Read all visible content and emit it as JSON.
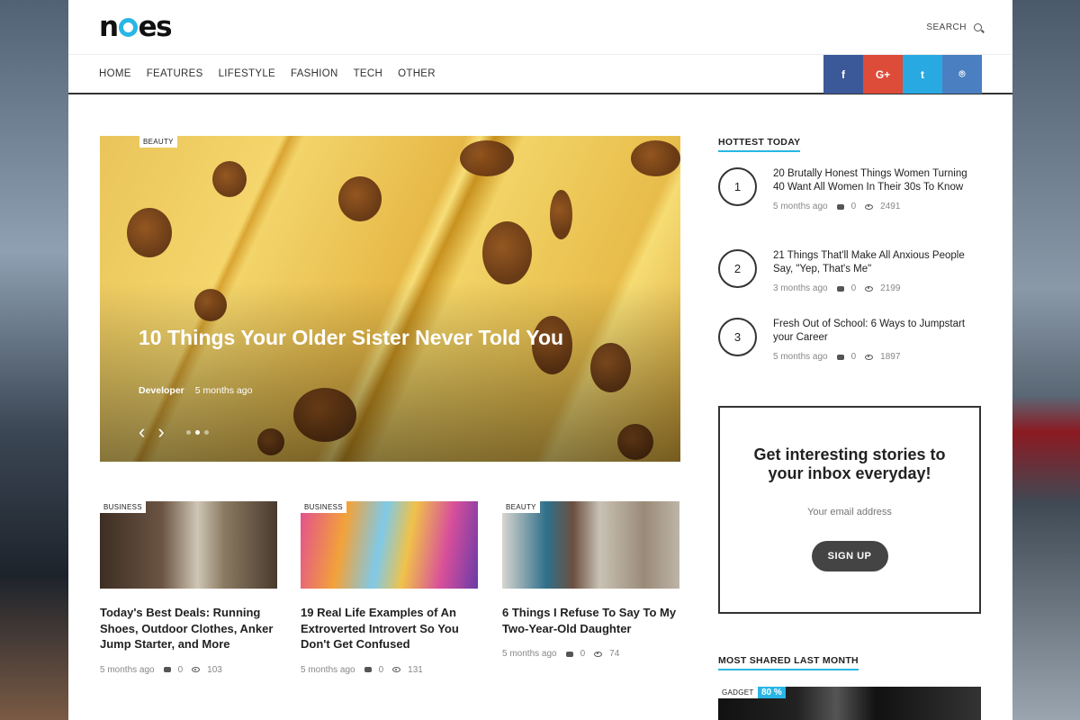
{
  "header": {
    "logo": "noes",
    "search_label": "SEARCH",
    "nav": [
      "HOME",
      "FEATURES",
      "LIFESTYLE",
      "FASHION",
      "TECH",
      "OTHER"
    ],
    "socials": [
      {
        "label": "f",
        "color": "#3b5998"
      },
      {
        "label": "G+",
        "color": "#dd4b39"
      },
      {
        "label": "t",
        "color": "#29a9e1"
      },
      {
        "label": "⌾",
        "color": "#4a7fc1"
      }
    ]
  },
  "hero": {
    "tag": "BEAUTY",
    "title": "10 Things Your Older Sister Never Told You",
    "author": "Developer",
    "time": "5 months ago",
    "slides_total": 3,
    "active_slide": 2
  },
  "cards": [
    {
      "tag": "BUSINESS",
      "title": "Today's Best Deals: Running Shoes, Outdoor Clothes, Anker Jump Starter, and More",
      "time": "5 months ago",
      "comments": "0",
      "views": "103"
    },
    {
      "tag": "BUSINESS",
      "title": "19 Real Life Examples of An Extroverted Introvert So You Don't Get Confused",
      "time": "5 months ago",
      "comments": "0",
      "views": "131"
    },
    {
      "tag": "BEAUTY",
      "title": "6 Things I Refuse To Say To My Two-Year-Old Daughter",
      "time": "5 months ago",
      "comments": "0",
      "views": "74"
    }
  ],
  "sidebar": {
    "hottest_heading": "HOTTEST TODAY",
    "hottest": [
      {
        "num": "1",
        "title": "20 Brutally Honest Things Women Turning 40 Want All Women In Their 30s To Know",
        "time": "5 months ago",
        "comments": "0",
        "views": "2491"
      },
      {
        "num": "2",
        "title": "21 Things That'll Make All Anxious People Say, \"Yep, That's Me\"",
        "time": "3 months ago",
        "comments": "0",
        "views": "2199"
      },
      {
        "num": "3",
        "title": "Fresh Out of School: 6 Ways to Jumpstart your Career",
        "time": "5 months ago",
        "comments": "0",
        "views": "1897"
      }
    ],
    "newsletter": {
      "title": "Get interesting stories to your inbox everyday!",
      "placeholder": "Your email address",
      "button": "SIGN UP"
    },
    "shared_heading": "MOST SHARED LAST MONTH",
    "shared_tag": "GADGET",
    "shared_pct": "80 %"
  }
}
